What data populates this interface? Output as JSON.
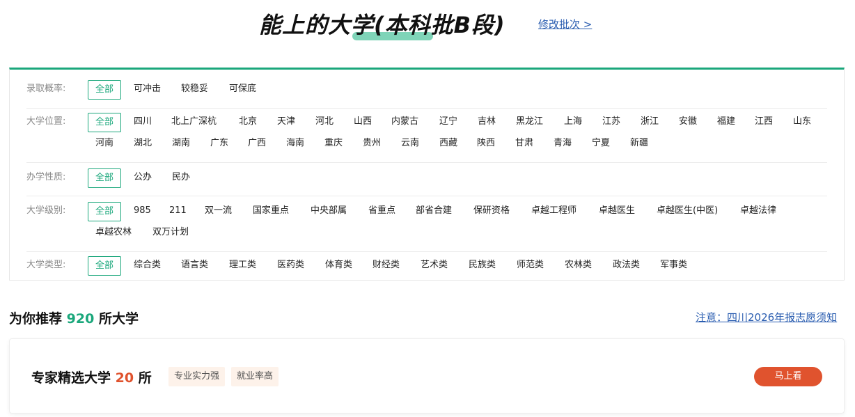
{
  "header": {
    "title": "能上的大学(本科批B段)",
    "change_batch": "修改批次 >"
  },
  "filters": {
    "probability": {
      "label": "录取概率:",
      "options": [
        "全部",
        "可冲击",
        "较稳妥",
        "可保底"
      ]
    },
    "location": {
      "label": "大学位置:",
      "options": [
        "全部",
        "四川",
        "北上广深杭",
        "北京",
        "天津",
        "河北",
        "山西",
        "内蒙古",
        "辽宁",
        "吉林",
        "黑龙江",
        "上海",
        "江苏",
        "浙江",
        "安徽",
        "福建",
        "江西",
        "山东",
        "河南",
        "湖北",
        "湖南",
        "广东",
        "广西",
        "海南",
        "重庆",
        "贵州",
        "云南",
        "西藏",
        "陕西",
        "甘肃",
        "青海",
        "宁夏",
        "新疆"
      ]
    },
    "nature": {
      "label": "办学性质:",
      "options": [
        "全部",
        "公办",
        "民办"
      ]
    },
    "level": {
      "label": "大学级别:",
      "options": [
        "全部",
        "985",
        "211",
        "双一流",
        "国家重点",
        "中央部属",
        "省重点",
        "部省合建",
        "保研资格",
        "卓越工程师",
        "卓越医生",
        "卓越医生(中医)",
        "卓越法律",
        "卓越农林",
        "双万计划"
      ]
    },
    "type": {
      "label": "大学类型:",
      "options": [
        "全部",
        "综合类",
        "语言类",
        "理工类",
        "医药类",
        "体育类",
        "财经类",
        "艺术类",
        "民族类",
        "师范类",
        "农林类",
        "政法类",
        "军事类"
      ]
    }
  },
  "recommend": {
    "prefix": "为你推荐",
    "count": "920",
    "suffix": "所大学",
    "notice": "注意：四川2026年报志愿须知"
  },
  "expert": {
    "prefix": "专家精选大学",
    "count": "20",
    "suffix": "所",
    "tags": [
      "专业实力强",
      "就业率高"
    ],
    "button": "马上看"
  },
  "colors": {
    "accent": "#1aa77b",
    "highlight": "#7fd4b8",
    "orange": "#e0532e",
    "link": "#2a5db0"
  }
}
